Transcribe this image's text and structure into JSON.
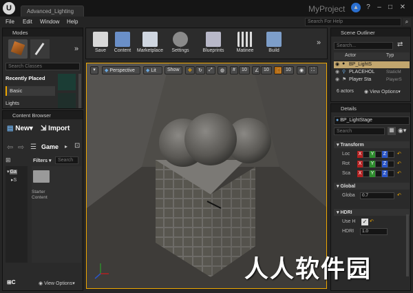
{
  "window": {
    "tab_title": "Advanced_Lighting",
    "project": "MyProject",
    "logo": "U"
  },
  "menu": [
    "File",
    "Edit",
    "Window",
    "Help"
  ],
  "help_search": {
    "placeholder": "Search For Help"
  },
  "modes": {
    "title": "Modes",
    "search_placeholder": "Search Classes",
    "categories": [
      "Recently Placed",
      "Basic",
      "Lights"
    ]
  },
  "content_browser": {
    "title": "Content Browser",
    "new_label": "New",
    "import_label": "Import",
    "path": "Game",
    "filters_label": "Filters",
    "search_placeholder": "Search",
    "tree": [
      "Ga",
      "S"
    ],
    "folder_label": "Starter Content",
    "view_options": "View Options",
    "collection_label": "C"
  },
  "toolbar": {
    "buttons": [
      {
        "label": "Save",
        "icon": "save-icon"
      },
      {
        "label": "Content",
        "icon": "content-icon"
      },
      {
        "label": "Marketplace",
        "icon": "marketplace-icon"
      },
      {
        "label": "Settings",
        "icon": "settings-icon"
      },
      {
        "label": "Blueprints",
        "icon": "blueprints-icon"
      },
      {
        "label": "Matinee",
        "icon": "matinee-icon"
      },
      {
        "label": "Build",
        "icon": "build-icon"
      }
    ]
  },
  "viewport": {
    "perspective": "Perspective",
    "lit": "Lit",
    "show": "Show",
    "snap1": "10",
    "snap2": "10",
    "snap3": "10"
  },
  "outliner": {
    "title": "Scene Outliner",
    "search_placeholder": "Search...",
    "col_actor": "Actor",
    "col_type": "Typ",
    "rows": [
      {
        "name": "BP_LightS",
        "type": "",
        "selected": true
      },
      {
        "name": "PLACEHOL",
        "type": "StaticM",
        "selected": false
      },
      {
        "name": "Player Sta",
        "type": "PlayerS",
        "selected": false
      }
    ],
    "count": "6 actors",
    "view_options": "View Options"
  },
  "details": {
    "title": "Details",
    "object_name": "BP_LightStage",
    "search_placeholder": "Search",
    "transform_header": "Transform",
    "rows": [
      {
        "label": "Loc"
      },
      {
        "label": "Rot"
      },
      {
        "label": "Sca"
      }
    ],
    "global_header": "Global",
    "global_label": "Globa",
    "global_value": "0.7",
    "hdri_header": "HDRI",
    "use_label": "Use H",
    "hdri_label": "HDRI",
    "hdri_value": "1.0"
  },
  "watermark": "人人软件园",
  "colors": {
    "accent": "#f0a800",
    "x": "#b42020",
    "y": "#2e8b2e",
    "z": "#2a55c8"
  }
}
